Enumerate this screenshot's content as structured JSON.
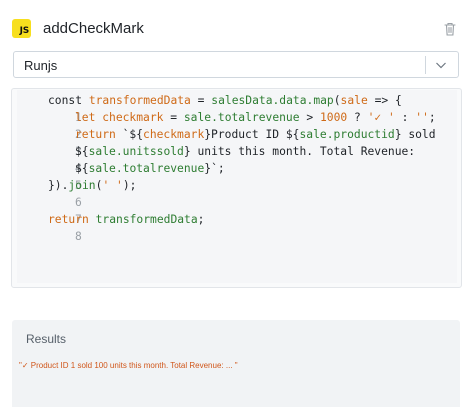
{
  "header": {
    "badge": "JS",
    "title": "addCheckMark"
  },
  "runner": {
    "selected": "Runjs"
  },
  "editor": {
    "line_numbers": [
      "1",
      "2",
      "3",
      "4",
      "5",
      "6",
      "7",
      "8"
    ],
    "tokens": {
      "l1": [
        "const",
        "transformedData",
        "=",
        "salesData.data.",
        "map",
        "(",
        "sale",
        "=>",
        "{"
      ],
      "l2": [
        "let",
        "checkmark",
        "=",
        "sale",
        ".",
        "totalrevenue",
        ">",
        "1000",
        "?",
        "'✓ '",
        ":",
        "''",
        ";"
      ],
      "l3": [
        "return",
        "`${",
        "checkmark",
        "}Product ID ${",
        "sale",
        ".",
        "productid",
        "} sold"
      ],
      "l4": [
        "${",
        "sale",
        ".",
        "unitssold",
        "} units this month. Total Revenue:"
      ],
      "l5": [
        "${",
        "sale",
        ".",
        "totalrevenue",
        "}`;"
      ],
      "l6": [
        "}).",
        "join",
        "(",
        "' '",
        ");"
      ],
      "l8": [
        "return",
        "transformedData",
        ";"
      ]
    }
  },
  "results": {
    "title": "Results",
    "output": "\"✓ Product ID 1 sold 100 units this month. Total Revenue: ... \""
  }
}
